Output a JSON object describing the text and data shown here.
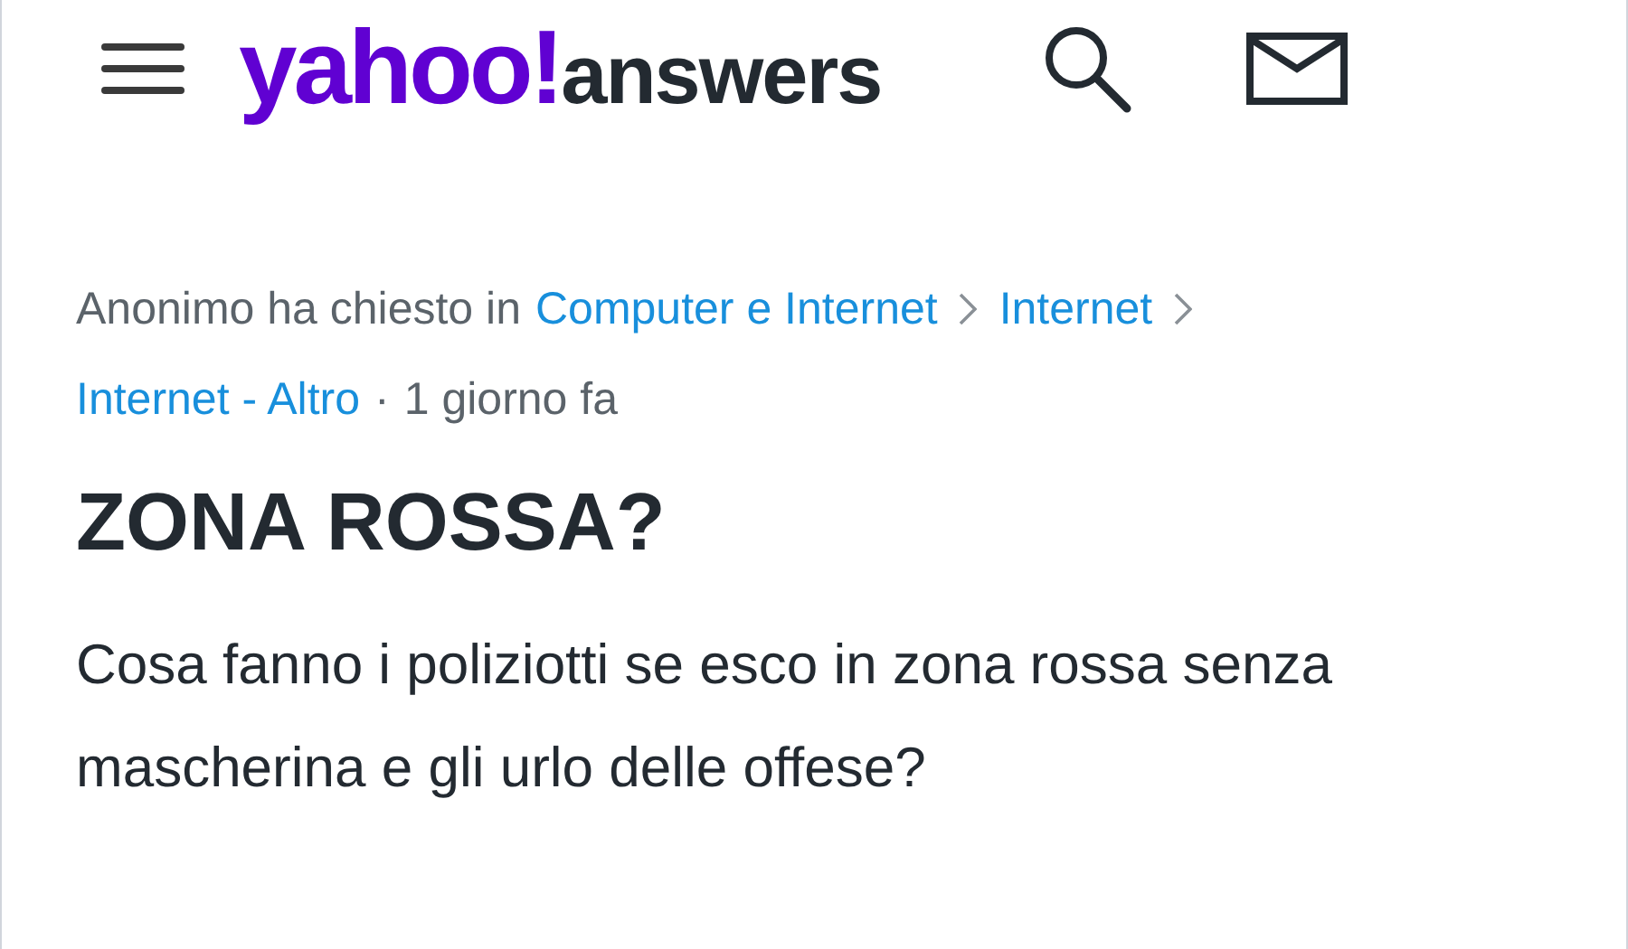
{
  "header": {
    "logo_brand": "yahoo!",
    "logo_product": "answers"
  },
  "question": {
    "asker_text": "Anonimo ha chiesto in",
    "categories": [
      "Computer e Internet",
      "Internet",
      "Internet - Altro"
    ],
    "separator": "·",
    "time": "1 giorno fa",
    "title": "ZONA ROSSA?",
    "body": "Cosa fanno i poliziotti se esco in zona rossa senza mascherina e gli urlo delle offese?"
  }
}
